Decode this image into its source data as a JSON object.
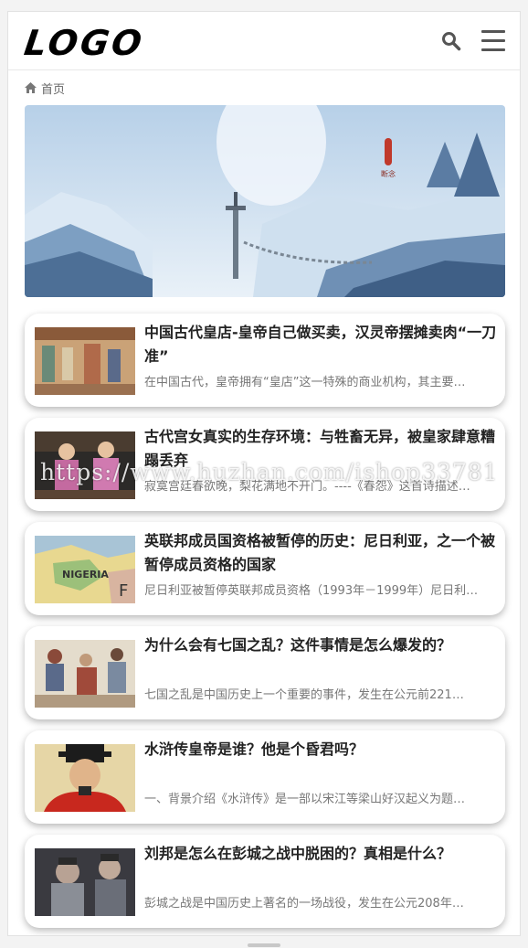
{
  "header": {
    "logo_text": "LOGO",
    "search_icon": "search-icon",
    "menu_icon": "hamburger-menu-icon"
  },
  "breadcrumb": {
    "icon": "home-icon",
    "label": "首页"
  },
  "banner": {
    "alt": "snowy mountain scene with sword and chain",
    "seal_text": "断念"
  },
  "articles": [
    {
      "title": "中国古代皇店-皇帝自己做买卖，汉灵帝摆摊卖肉“一刀准”",
      "summary": "在中国古代，皇帝拥有“皇店”这一特殊的商业机构，其主要…"
    },
    {
      "title": "古代宫女真实的生存环境：与牲畜无异，被皇家肆意糟蹋丢弃",
      "summary": "寂寞宫廷春欲晚，梨花满地不开门。----《春怨》这首诗描述…"
    },
    {
      "title": "英联邦成员国资格被暂停的历史：尼日利亚，之一个被暂停成员资格的国家",
      "summary": "尼日利亚被暂停英联邦成员资格（1993年－1999年）尼日利…"
    },
    {
      "title": "为什么会有七国之乱？这件事情是怎么爆发的？",
      "summary": "七国之乱是中国历史上一个重要的事件，发生在公元前221…"
    },
    {
      "title": "水浒传皇帝是谁？他是个昏君吗？",
      "summary": "一、背景介绍《水浒传》是一部以宋江等梁山好汉起义为题…"
    },
    {
      "title": "刘邦是怎么在彭城之战中脱困的？真相是什么？",
      "summary": "彭城之战是中国历史上著名的一场战役，发生在公元208年…"
    }
  ],
  "watermark": "https://www.huzhan.com/ishop33781",
  "colors": {
    "text_title": "#222222",
    "text_summary": "#777777",
    "icon_gray": "#555555"
  }
}
